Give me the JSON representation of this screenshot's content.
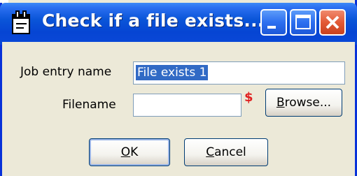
{
  "window": {
    "title": "Check if a file exists...",
    "buttons": {
      "minimize": "minimize-icon",
      "maximize": "maximize-icon",
      "close": "close-icon"
    }
  },
  "form": {
    "job_entry_label": "Job entry name",
    "job_entry_value": "File exists 1",
    "filename_label": "Filename",
    "filename_value": "",
    "variable_marker": "$",
    "browse_button": {
      "mnemonic": "B",
      "rest": "rowse..."
    }
  },
  "footer": {
    "ok_button": {
      "mnemonic": "O",
      "rest": "K"
    },
    "cancel_button": {
      "mnemonic": "C",
      "rest": "ancel"
    }
  },
  "colors": {
    "titlebar": "#0a55d8",
    "close_button": "#e35a36",
    "selection": "#316ac5",
    "variable_marker": "#e02020",
    "dialog_bg": "#ece9d8"
  }
}
